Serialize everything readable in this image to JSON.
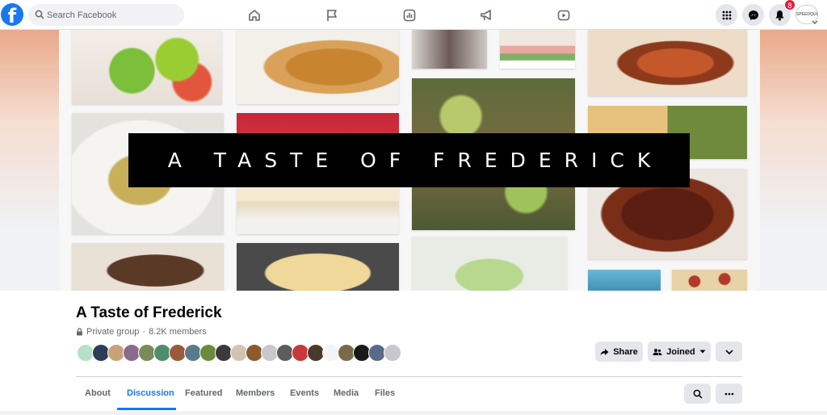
{
  "topbar": {
    "logo": "f",
    "search_placeholder": "Search Facebook",
    "nav_icons": [
      "home-icon",
      "flag-icon",
      "chart-icon",
      "megaphone-icon",
      "video-icon"
    ],
    "notifications_count": "8",
    "profile_label": "SPEEDQUEEN"
  },
  "cover": {
    "banner_text": "A TASTE OF FREDERICK"
  },
  "group": {
    "name": "A Taste of Frederick",
    "privacy": "Private group",
    "separator": "·",
    "members": "8.2K members"
  },
  "actions": {
    "share": "Share",
    "joined": "Joined"
  },
  "tabs": [
    {
      "label": "About"
    },
    {
      "label": "Discussion"
    },
    {
      "label": "Featured"
    },
    {
      "label": "Members"
    },
    {
      "label": "Events"
    },
    {
      "label": "Media"
    },
    {
      "label": "Files"
    }
  ],
  "colors": {
    "accent": "#1877f2",
    "badge": "#e41e3f"
  }
}
